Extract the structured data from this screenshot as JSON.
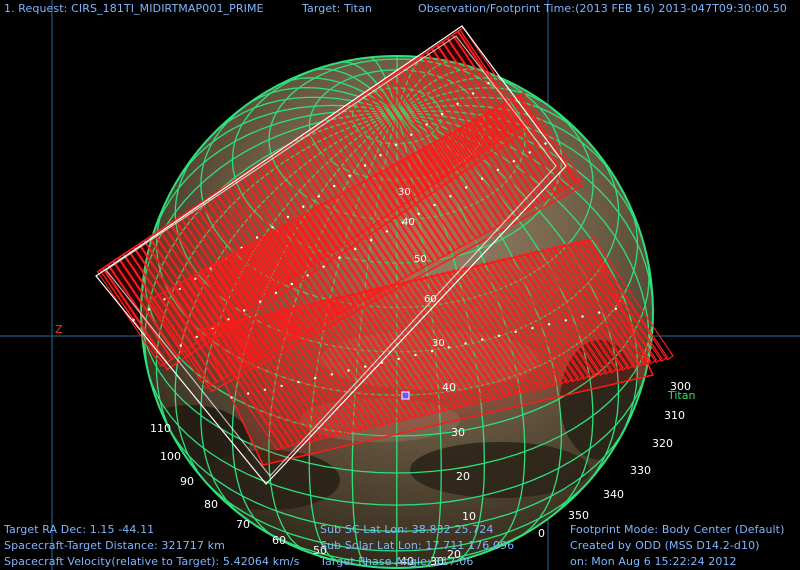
{
  "header": {
    "request": "1. Request: CIRS_181TI_MIDIRTMAP001_PRIME",
    "target": "Target: Titan",
    "obs_time": "Observation/Footprint Time:(2013 FEB 16) 2013-047T09:30:00.50"
  },
  "body_label": "Titan",
  "axis_label": "Z",
  "lat_labels": [
    "30",
    "40",
    "50",
    "60",
    "30",
    "40",
    "30",
    "20",
    "10",
    "0"
  ],
  "lon_labels": [
    "300",
    "310",
    "320",
    "330",
    "340",
    "350",
    "110",
    "100",
    "90",
    "80",
    "70",
    "60",
    "50",
    "40",
    "30",
    "20"
  ],
  "footer": {
    "ra_dec": "Target RA Dec:  1.15   -44.11",
    "distance": "Spacecraft-Target Distance:  321717 km",
    "velocity": "Spacecraft Velocity(relative to Target): 5.42064 km/s",
    "sub_sc": "Sub SC Lat Lon: 38.832  25.724",
    "sub_solar": "Sub Solar Lat Lon: 17.711  176.096",
    "phase": "Target Phase Angle: 117.06",
    "mode": "Footprint Mode: Body Center (Default)",
    "created": "Created by ODD (MSS D14.2-d10)",
    "date": "on: Mon Aug  6 15:22:24 2012"
  },
  "colors": {
    "background": "#000000",
    "text": "#7fb6ff",
    "grid": "#2ee07a",
    "footprint": "#ff1a1a",
    "outline": "#ffffff",
    "crosshair": "#1f6f9e",
    "marker": "#7a4dff",
    "body_label": "#30e060"
  }
}
